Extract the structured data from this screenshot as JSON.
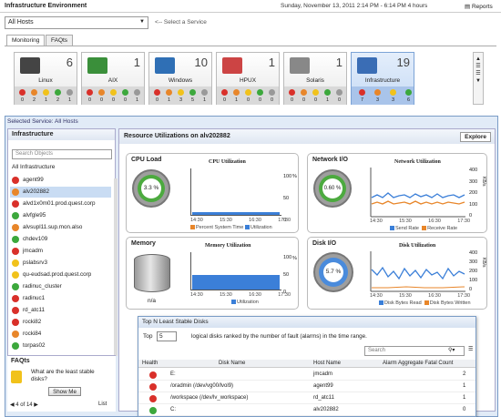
{
  "app": {
    "title": "Infrastructure Environment",
    "datetime": "Sunday, November 13, 2011 2:14 PM - 6:14 PM 4 hours",
    "reports": "Reports"
  },
  "host_select": {
    "value": "All Hosts",
    "hint": "<-- Select a Service"
  },
  "tabs": [
    {
      "label": "Monitoring"
    },
    {
      "label": "FAQts"
    }
  ],
  "tiles": [
    {
      "name": "Linux",
      "count": "6",
      "stats": [
        "0",
        "2",
        "1",
        "2",
        "1"
      ]
    },
    {
      "name": "AIX",
      "count": "1",
      "stats": [
        "0",
        "0",
        "0",
        "0",
        "1"
      ]
    },
    {
      "name": "Windows",
      "count": "10",
      "stats": [
        "0",
        "1",
        "3",
        "5",
        "1"
      ]
    },
    {
      "name": "HPUX",
      "count": "1",
      "stats": [
        "0",
        "1",
        "0",
        "0",
        "0"
      ]
    },
    {
      "name": "Solaris",
      "count": "1",
      "stats": [
        "0",
        "0",
        "0",
        "1",
        "0"
      ]
    },
    {
      "name": "Infrastructure",
      "count": "19",
      "stats": [
        "7",
        "3",
        "3",
        "6"
      ]
    }
  ],
  "selected_service": {
    "label": "Selected Service:",
    "value": "All Hosts"
  },
  "left_panel": {
    "title": "Infrastructure",
    "search_placeholder": "Search Objects",
    "root": "All Infrastructure",
    "hosts": [
      {
        "name": "agent99",
        "status": "red"
      },
      {
        "name": "alv202882",
        "status": "orange"
      },
      {
        "name": "alvd1x0m01.prod.quest.corp",
        "status": "red"
      },
      {
        "name": "alvfgle95",
        "status": "green"
      },
      {
        "name": "alvsupl11.sup.mon.also",
        "status": "orange"
      },
      {
        "name": "chdev109",
        "status": "green"
      },
      {
        "name": "jmcadm",
        "status": "red"
      },
      {
        "name": "pslabsrv3",
        "status": "yellow"
      },
      {
        "name": "qu-eudsad.prod.quest.corp",
        "status": "yellow"
      },
      {
        "name": "radinuc_cluster",
        "status": "green"
      },
      {
        "name": "radinuc1",
        "status": "red"
      },
      {
        "name": "rd_atc11",
        "status": "red"
      },
      {
        "name": "rocki82",
        "status": "red"
      },
      {
        "name": "rocki84",
        "status": "orange"
      },
      {
        "name": "torpas02",
        "status": "green"
      }
    ]
  },
  "faqs": {
    "title": "FAQts",
    "question": "What are the least stable disks?",
    "button": "Show Me",
    "pager": "4 of 14",
    "list": "List"
  },
  "resource": {
    "title": "Resource Utilizations on alv202882",
    "explore": "Explore"
  },
  "cpu": {
    "title": "CPU Load",
    "gauge": "3.3 %",
    "chart_title": "CPU Utilization",
    "legend": [
      "Percent System Time",
      "Utilization"
    ],
    "xticks": [
      "14:30",
      "15:30",
      "16:30",
      "17:30"
    ],
    "yticks": [
      "100",
      "50",
      "0"
    ],
    "yunit": "%"
  },
  "network": {
    "title": "Network I/O",
    "gauge": "0.60 %",
    "chart_title": "Network Utilization",
    "legend": [
      "Send Rate",
      "Receive Rate"
    ],
    "xticks": [
      "14:30",
      "15:30",
      "16:30",
      "17:30"
    ],
    "yticks": [
      "400",
      "300",
      "200",
      "100",
      "0"
    ],
    "yunit": "KB/s"
  },
  "memory": {
    "title": "Memory",
    "gauge": "n/a",
    "chart_title": "Memory Utilization",
    "legend": [
      "Utilization"
    ],
    "xticks": [
      "14:30",
      "15:30",
      "16:30",
      "17:30"
    ],
    "yticks": [
      "100",
      "50",
      "0"
    ],
    "yunit": "%"
  },
  "disk": {
    "title": "Disk I/O",
    "gauge": "5.7 %",
    "chart_title": "Disk Utilization",
    "legend": [
      "Disk Bytes Read",
      "Disk Bytes Written"
    ],
    "xticks": [
      "14:30",
      "15:30",
      "16:30",
      "17:30"
    ],
    "yticks": [
      "400",
      "300",
      "200",
      "100",
      "0"
    ],
    "yunit": "KB/s"
  },
  "dialog": {
    "title": "Top N Least Stable Disks",
    "top_label": "Top",
    "top_value": "5",
    "desc": "logical disks ranked by the number of fault (alarms) in the time range.",
    "search_placeholder": "Search",
    "columns": [
      "Health",
      "Disk Name",
      "Host Name",
      "Alarm Aggregate Fatal Count"
    ],
    "rows": [
      {
        "health": "red",
        "disk": "E:",
        "host": "jmcadm",
        "count": "2"
      },
      {
        "health": "red",
        "disk": "/oradmin (/dev/vg00/lvol9)",
        "host": "agent99",
        "count": "1"
      },
      {
        "health": "red",
        "disk": "/workspace (/dev/lv_workspace)",
        "host": "rd_atc11",
        "count": "1"
      },
      {
        "health": "green",
        "disk": "C:",
        "host": "alv202882",
        "count": "0"
      }
    ]
  },
  "colors": {
    "red": "#d9302a",
    "orange": "#e8862a",
    "yellow": "#f1c21b",
    "green": "#3ca83c",
    "accent": "#4a7bc0"
  }
}
